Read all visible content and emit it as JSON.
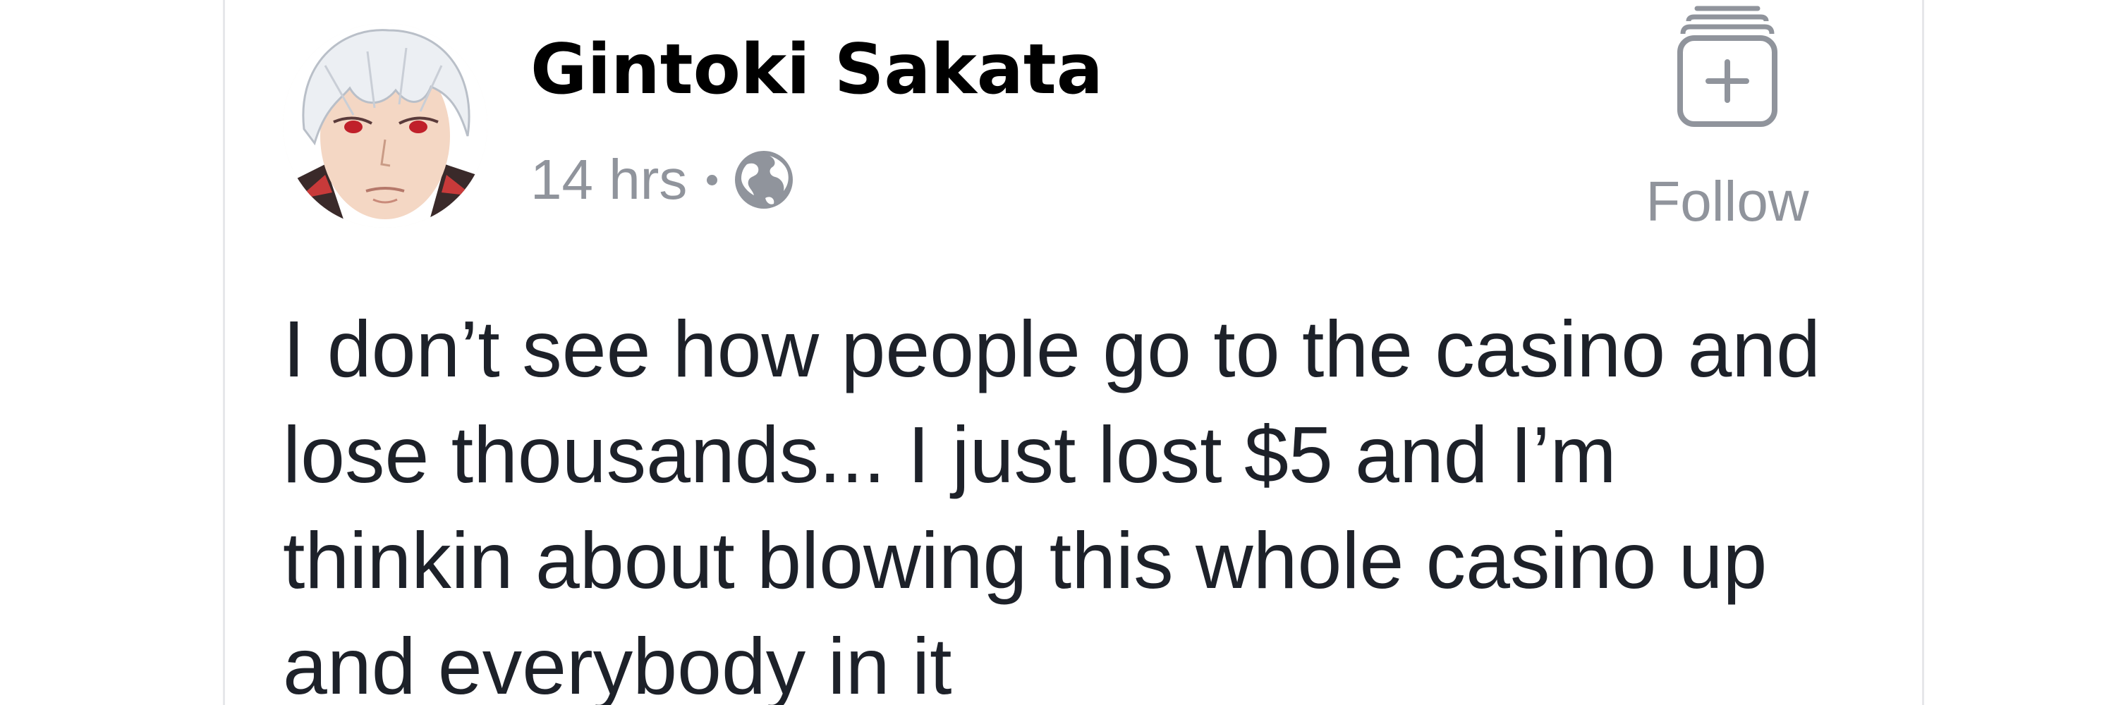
{
  "post": {
    "author": "Gintoki Sakata",
    "time": "14 hrs",
    "audience_icon": "globe-icon",
    "follow_label": "Follow",
    "follow_icon": "follow-add-icon",
    "text_lines": [
      "I don’t see how people go to the casino and",
      "lose thousands... I just lost $5 and I’m",
      "thinkin about blowing this whole casino up",
      "and everybody in it"
    ]
  },
  "colors": {
    "name": "#000000",
    "meta": "#90949c",
    "body_text": "#1d2129",
    "card_border": "#e6e7ea"
  }
}
